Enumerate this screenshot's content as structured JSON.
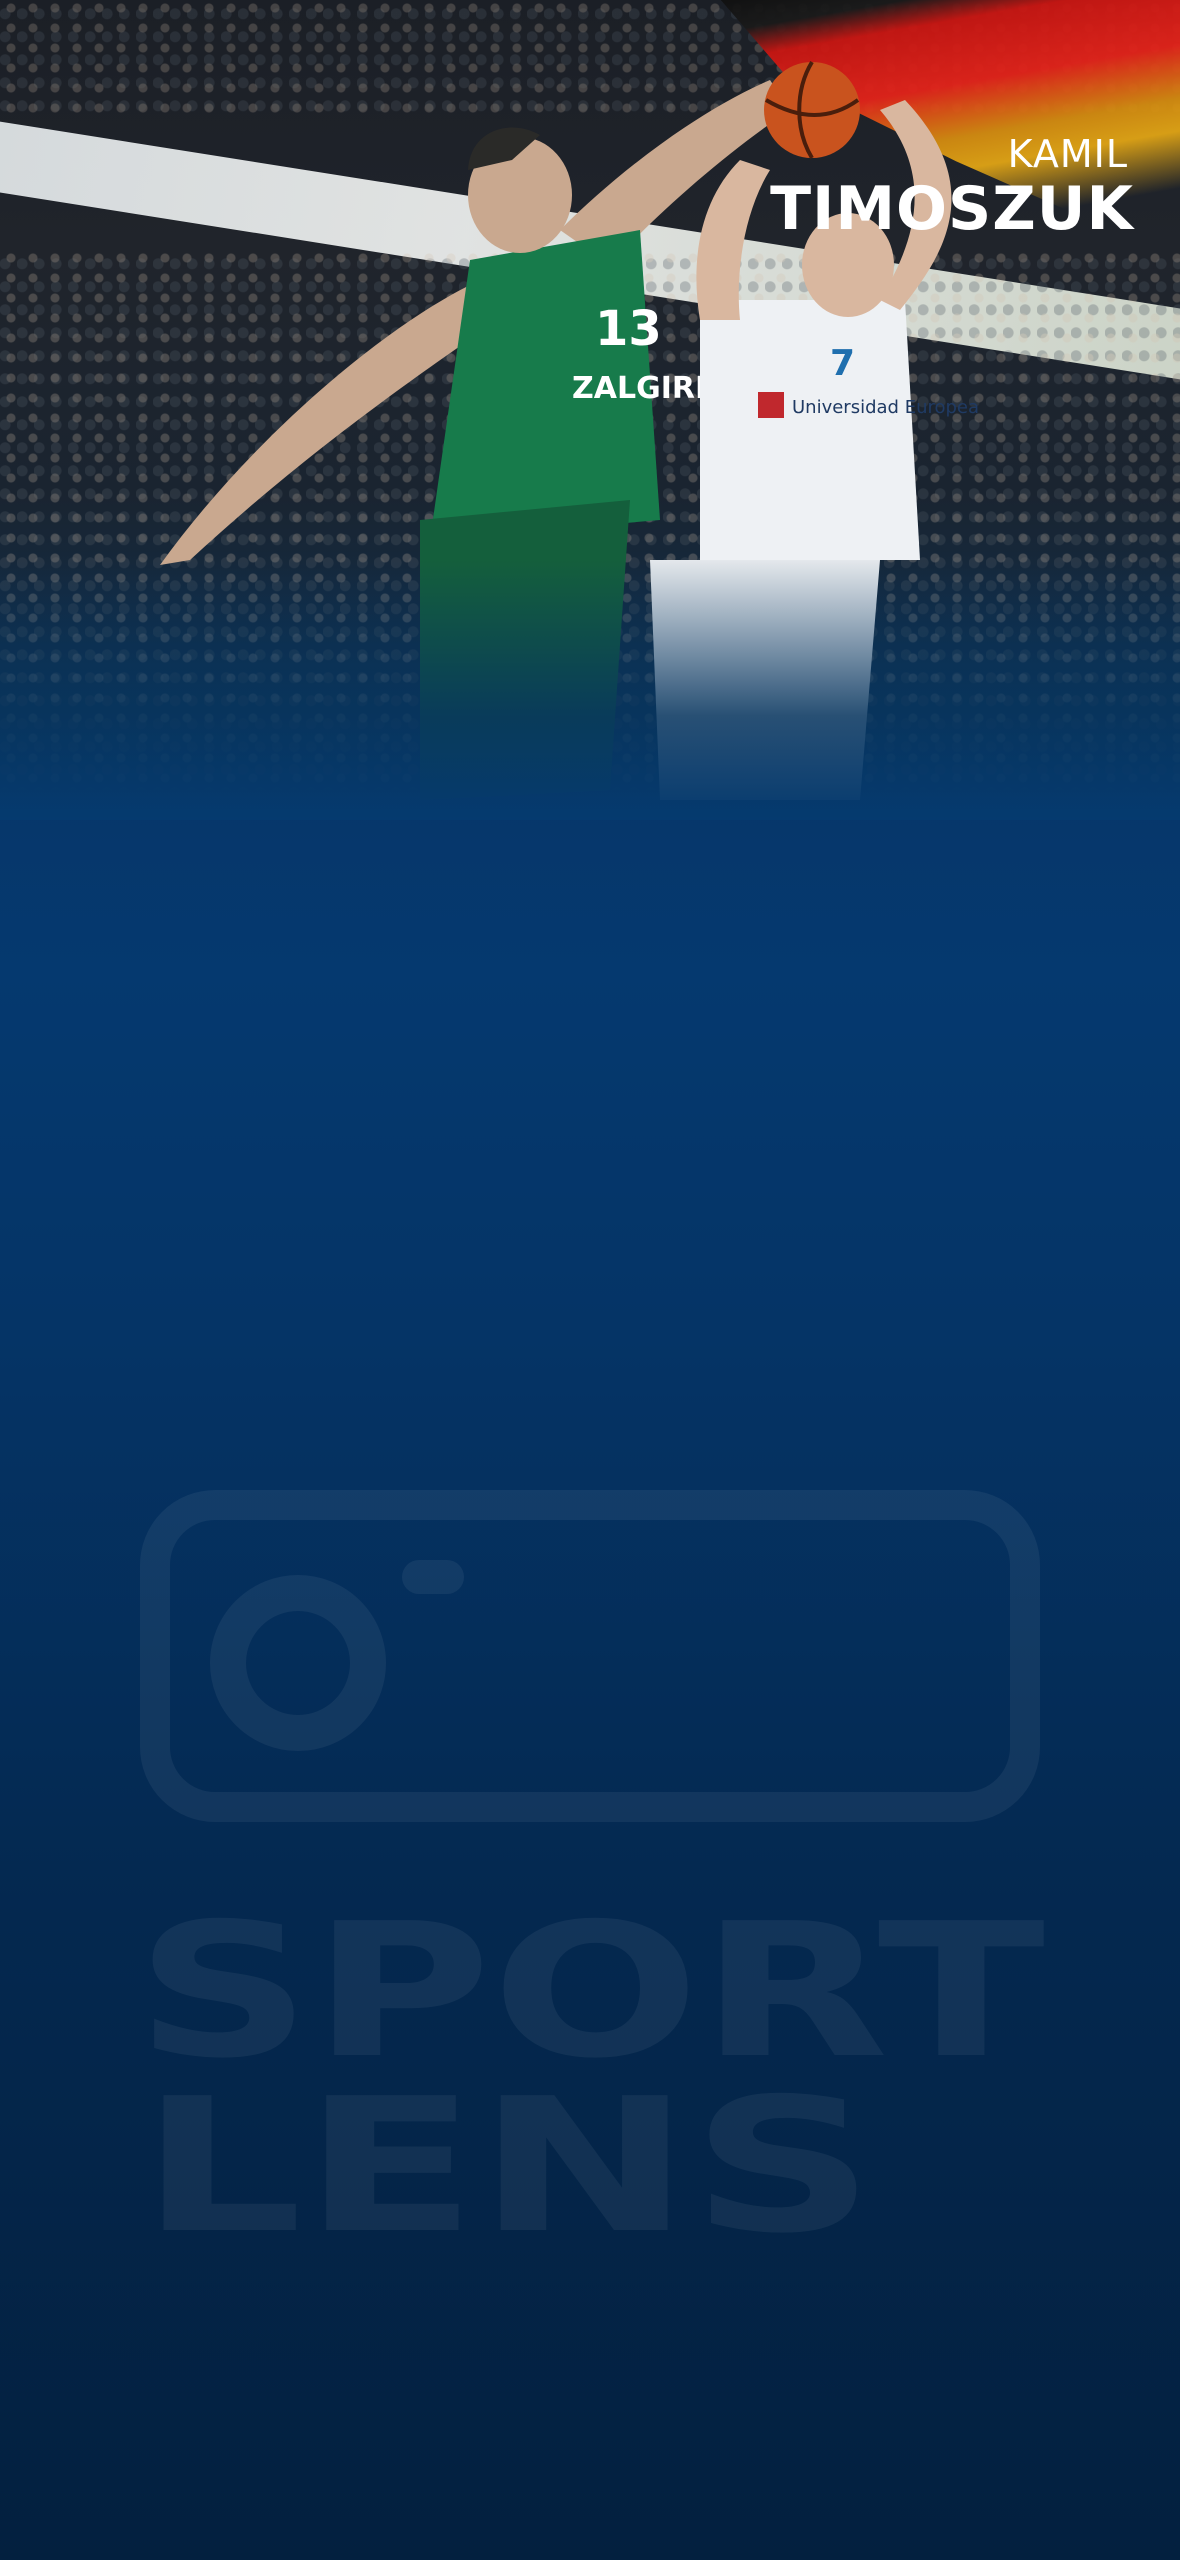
{
  "player": {
    "first_name": "KAMIL",
    "last_name": "TIMOSZUK",
    "flag_icon": "germany-flag-icon"
  },
  "hero": {
    "jersey_green_number": "13",
    "jersey_green_text": "ZALGIRIS",
    "jersey_white_number": "7",
    "jersey_white_text": "Universidad Europea"
  },
  "watermark": {
    "line1": "SPORT",
    "line2": "LENS",
    "icon": "camera-icon"
  },
  "colors": {
    "background_top": "#053a6f",
    "background_bottom": "#03203f",
    "green_jersey": "#177b4b",
    "white_jersey": "#f2f4f6"
  }
}
